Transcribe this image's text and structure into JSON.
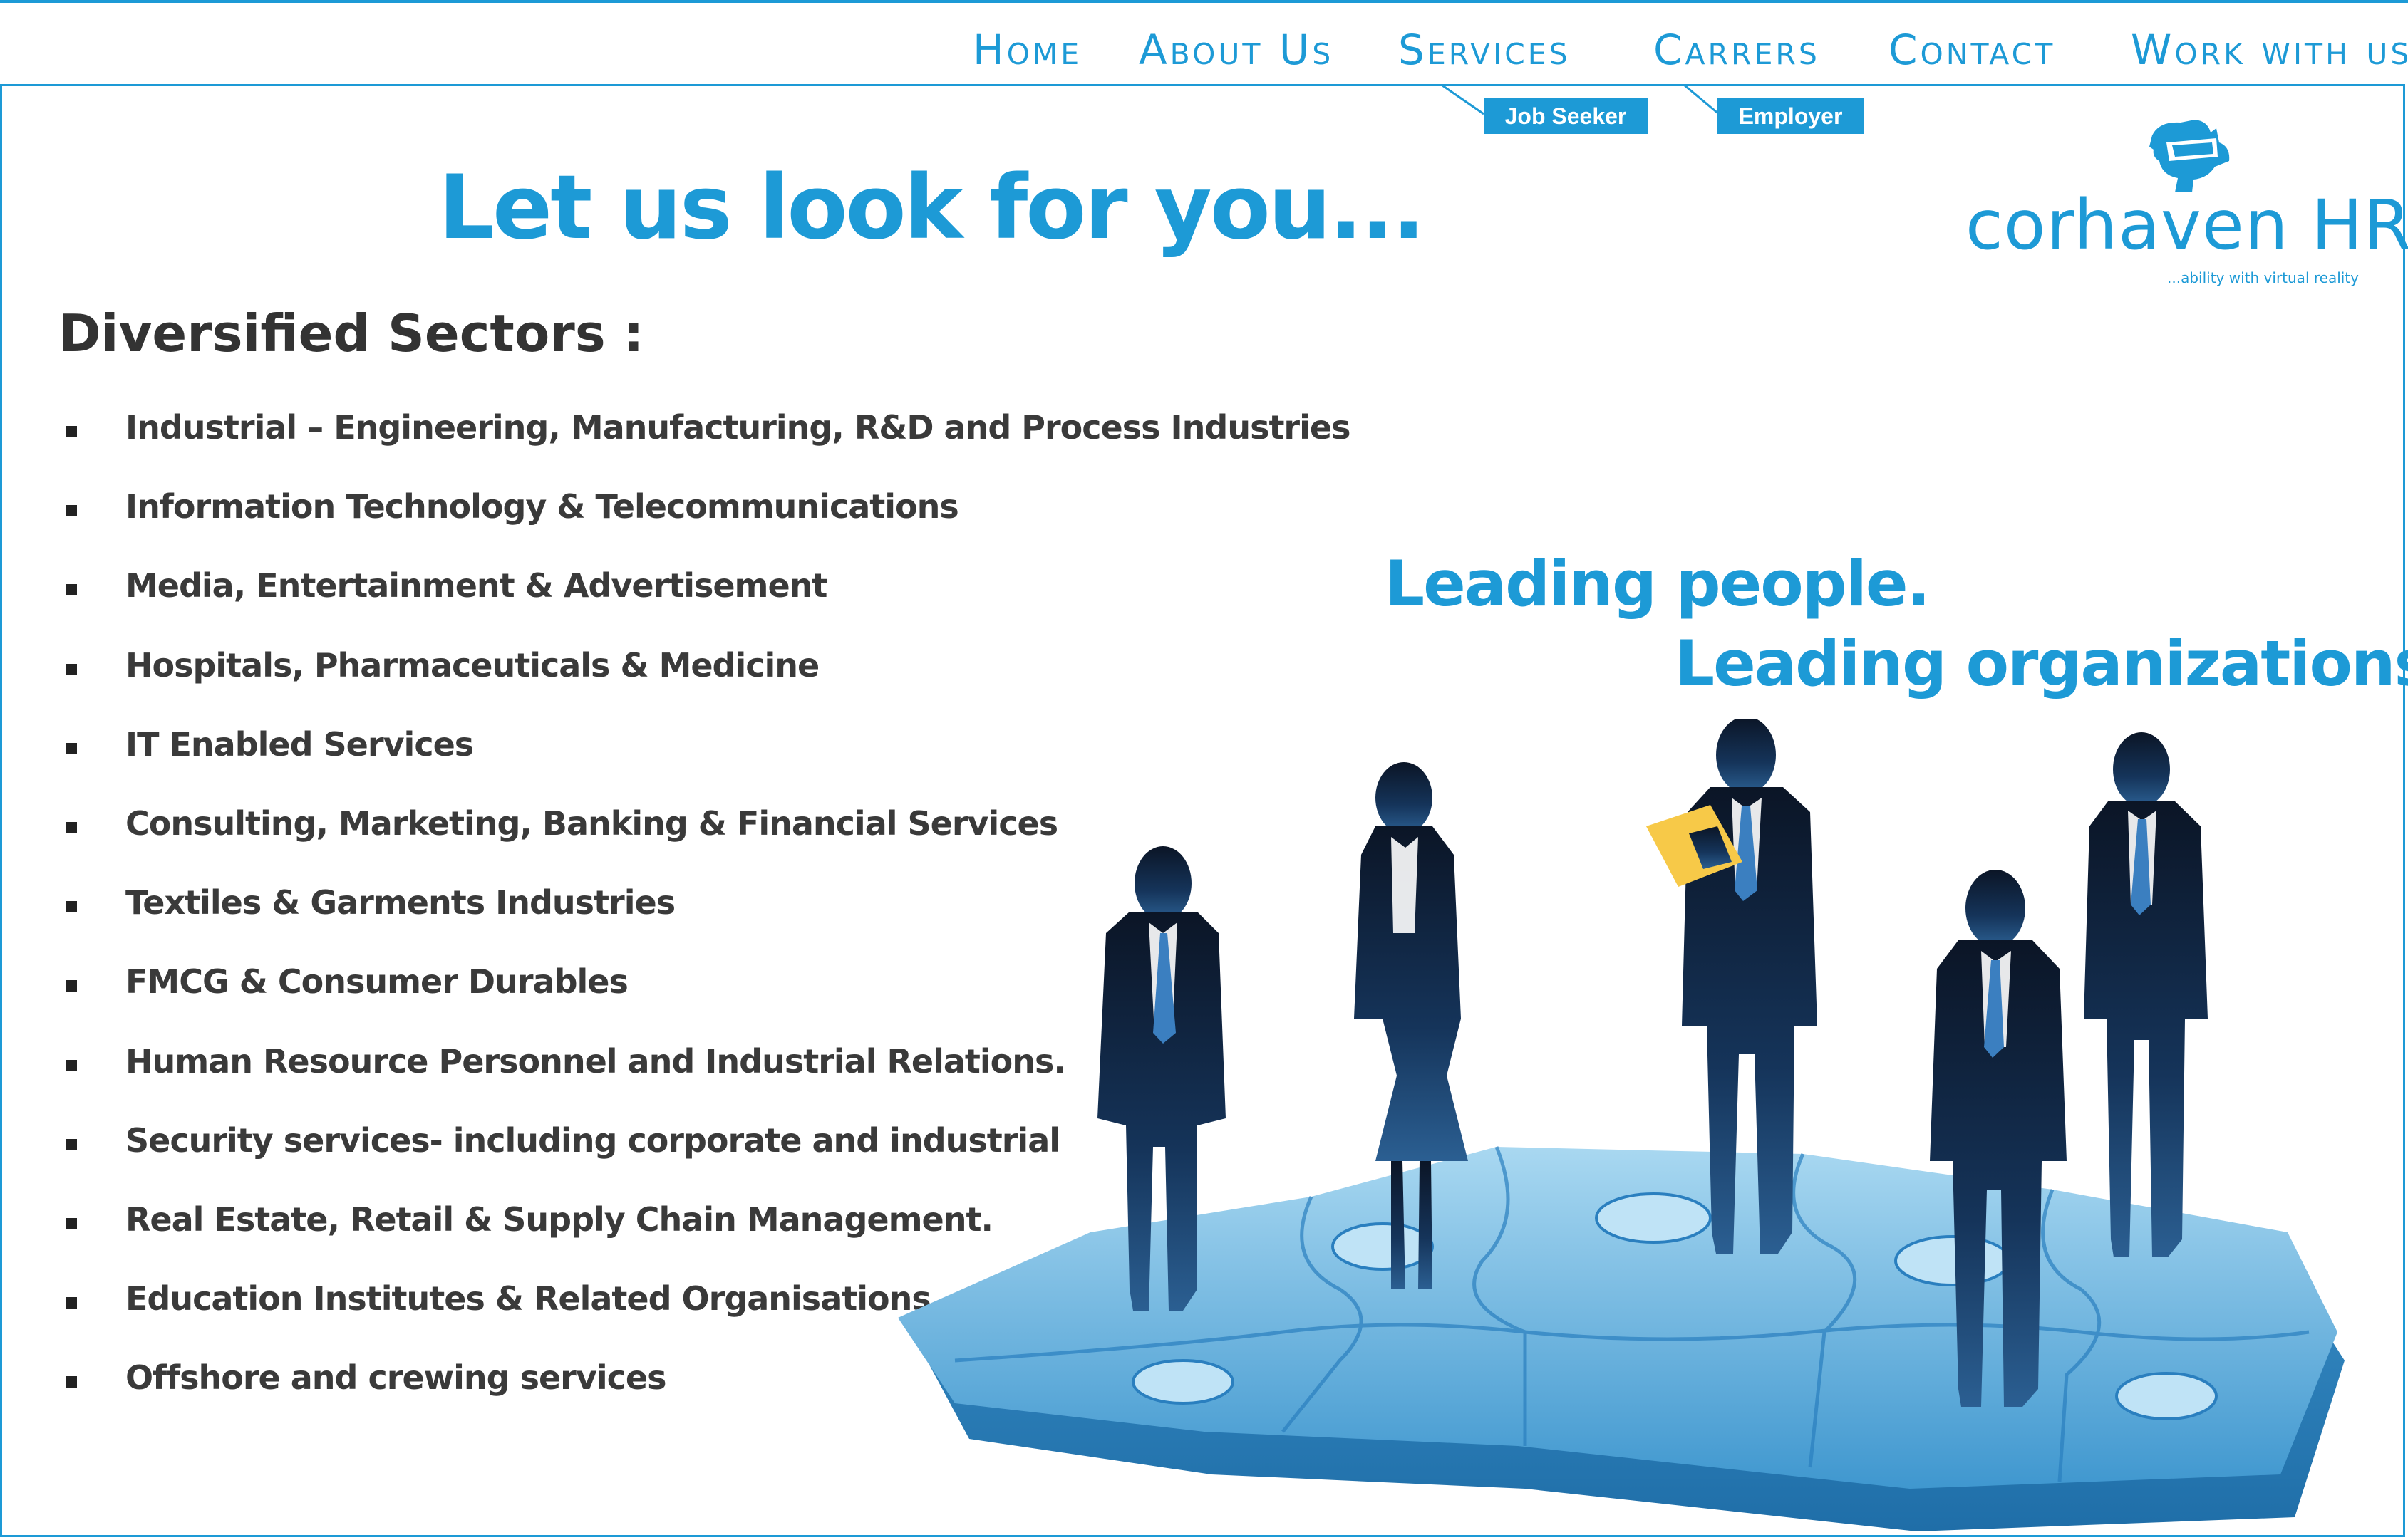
{
  "nav": {
    "items": [
      {
        "label": "Home"
      },
      {
        "label": "About Us"
      },
      {
        "label": "Services"
      },
      {
        "label": "Carrers"
      },
      {
        "label": "Contact"
      },
      {
        "label": "Work with us"
      }
    ],
    "submenus": {
      "job_seeker": "Job Seeker",
      "employer": "Employer"
    }
  },
  "hero": {
    "title": "Let us look for you..."
  },
  "logo": {
    "name": "corhaven HR",
    "tagline": "...ability with virtual reality"
  },
  "sectors": {
    "title": "Diversified Sectors :",
    "items": [
      "Industrial – Engineering, Manufacturing, R&D and Process Industries",
      "Information Technology & Telecommunications",
      "Media, Entertainment & Advertisement",
      "Hospitals, Pharmaceuticals & Medicine",
      "IT Enabled Services",
      "Consulting, Marketing, Banking & Financial Services",
      "Textiles & Garments Industries",
      "FMCG & Consumer Durables",
      "Human Resource Personnel and Industrial Relations.",
      "Security services- including corporate and industrial",
      "Real Estate, Retail & Supply Chain Management.",
      "Education Institutes & Related Organisations.",
      "Offshore and crewing services"
    ]
  },
  "tagline": {
    "line1": "Leading people.",
    "line2": "Leading organizations."
  },
  "colors": {
    "brand_blue": "#1d9ad6",
    "text_dark": "#3a3a3a",
    "figure_navy": "#0f2744",
    "puzzle_blue": "#5fb0dc"
  }
}
